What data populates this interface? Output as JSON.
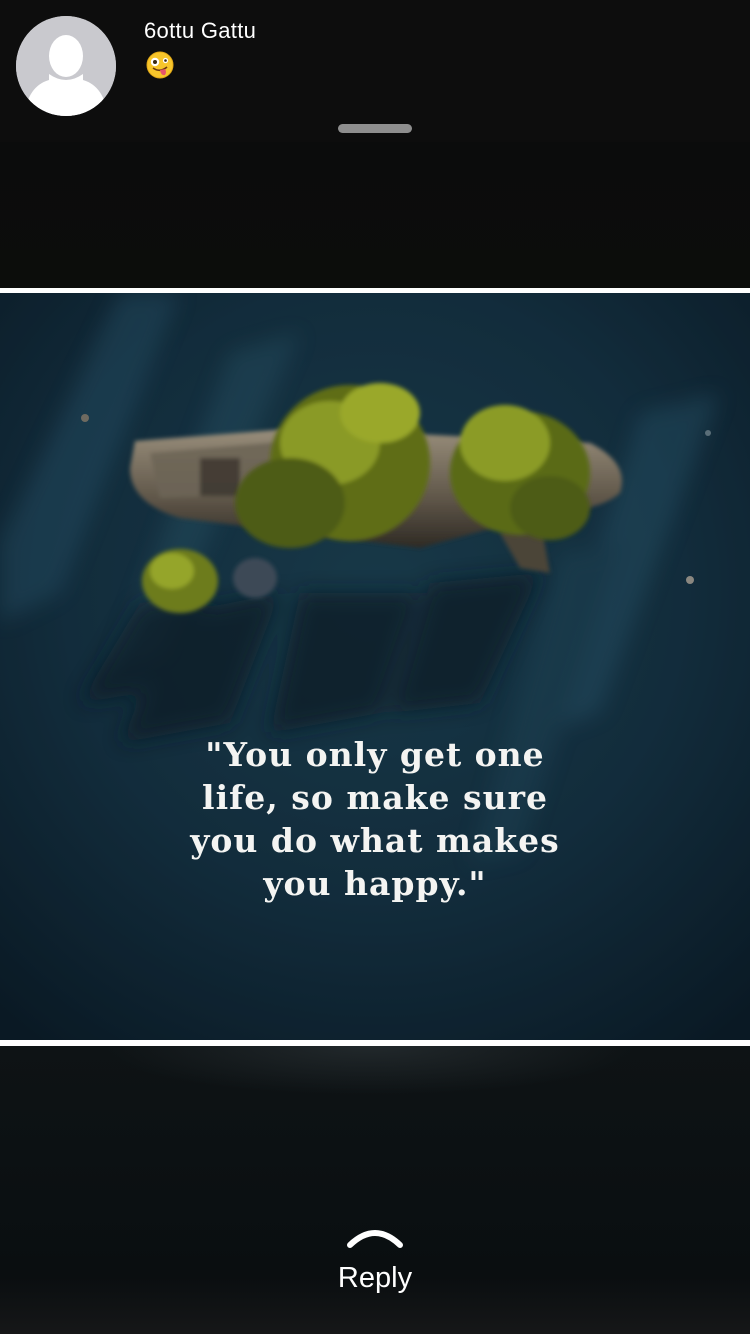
{
  "header": {
    "contact_name": "6ottu Gattu",
    "status_emoji_icon": "zany-face-emoji"
  },
  "status": {
    "quote_lines": [
      "\"You only get one",
      "life, so make sure",
      "you do what makes",
      "you happy.\""
    ]
  },
  "reply": {
    "label": "Reply",
    "icon": "chevron-up-icon"
  },
  "colors": {
    "background": "#0b0c0d",
    "header": "#0d0d0d",
    "water": "#132c3c",
    "text": "#ffffff"
  }
}
